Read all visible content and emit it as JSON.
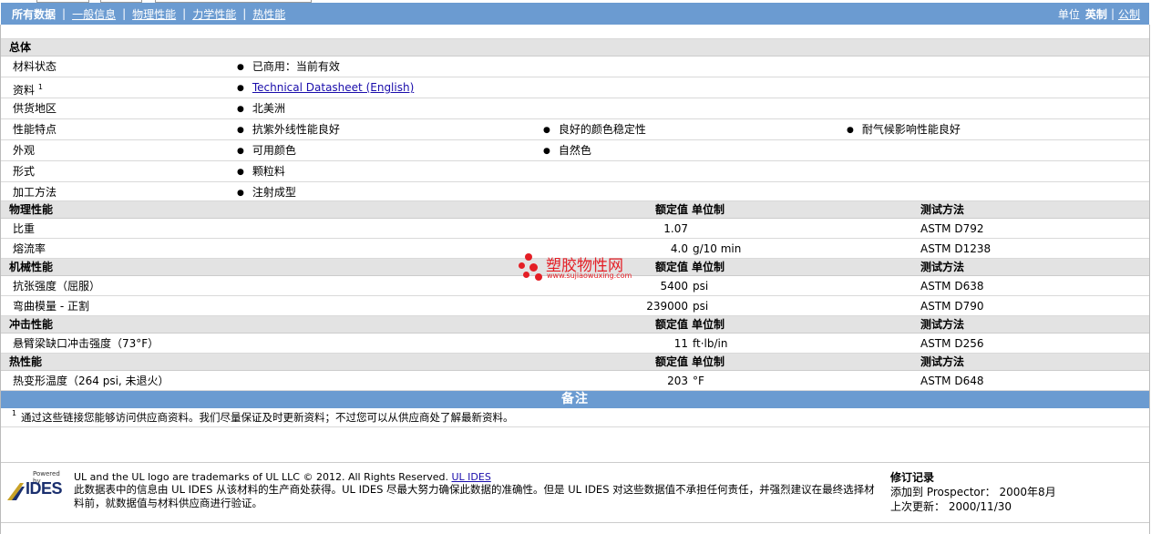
{
  "nav": {
    "tabs": [
      "所有数据",
      "一般信息",
      "物理性能",
      "力学性能",
      "热性能"
    ],
    "unit_label": "单位",
    "unit_active": "英制",
    "unit_other": "公制"
  },
  "general": {
    "title": "总体",
    "rows": [
      {
        "label": "材料状态",
        "items": [
          "已商用：当前有效"
        ]
      },
      {
        "label": "资料",
        "sup": "1",
        "link": "Technical Datasheet (English)"
      },
      {
        "label": "供货地区",
        "items": [
          "北美洲"
        ]
      },
      {
        "label": "性能特点",
        "items": [
          "抗紫外线性能良好",
          "良好的颜色稳定性",
          "耐气候影响性能良好"
        ]
      },
      {
        "label": "外观",
        "items": [
          "可用颜色",
          "自然色"
        ]
      },
      {
        "label": "形式",
        "items": [
          "颗粒料"
        ]
      },
      {
        "label": "加工方法",
        "items": [
          "注射成型"
        ]
      }
    ]
  },
  "col_headers": {
    "nominal": "额定值",
    "unit": "单位制",
    "method": "测试方法"
  },
  "physical": {
    "title": "物理性能",
    "rows": [
      {
        "label": "比重",
        "value": "1.07",
        "unit": "",
        "method": "ASTM D792"
      },
      {
        "label": "熔流率",
        "value": "4.0",
        "unit": "g/10 min",
        "method": "ASTM D1238"
      }
    ]
  },
  "mechanical": {
    "title": "机械性能",
    "rows": [
      {
        "label": "抗张强度（屈服）",
        "value": "5400",
        "unit": "psi",
        "method": "ASTM D638"
      },
      {
        "label": "弯曲模量 - 正割",
        "value": "239000",
        "unit": "psi",
        "method": "ASTM D790"
      }
    ]
  },
  "impact": {
    "title": "冲击性能",
    "rows": [
      {
        "label": "悬臂梁缺口冲击强度（73°F）",
        "value": "11",
        "unit": "ft·lb/in",
        "method": "ASTM D256"
      }
    ]
  },
  "thermal": {
    "title": "热性能",
    "rows": [
      {
        "label": "热变形温度（264 psi, 未退火）",
        "value": "203",
        "unit": "°F",
        "method": "ASTM D648"
      }
    ]
  },
  "notes": {
    "title": "备注",
    "sup": "1",
    "text": "通过这些链接您能够访问供应商资料。我们尽量保证及时更新资料；不过您可以从供应商处了解最新资料。"
  },
  "footer": {
    "powered_by": "Powered by",
    "logo_text": "IDES",
    "trademark": "UL and the UL logo are trademarks of UL LLC © 2012. All Rights Reserved.",
    "ul_ides_link": "UL IDES",
    "disclaimer": "此数据表中的信息由  UL IDES 从该材料的生产商处获得。UL IDES 尽最大努力确保此数据的准确性。但是  UL IDES 对这些数据值不承担任何责任，并强烈建议在最终选择材料前，就数据值与材料供应商进行验证。",
    "revision_title": "修订记录",
    "added_label": "添加到  Prospector：",
    "added_value": "2000年8月",
    "updated_label": "上次更新：",
    "updated_value": "2000/11/30"
  },
  "watermark": {
    "text": "塑胶物性网",
    "url": "www.sujiaowuxing.com",
    "color": "#e41e25"
  },
  "colors": {
    "nav_bar": "#6b9bd1",
    "section_head": "#e3e3e3",
    "link": "#1a0dab"
  }
}
